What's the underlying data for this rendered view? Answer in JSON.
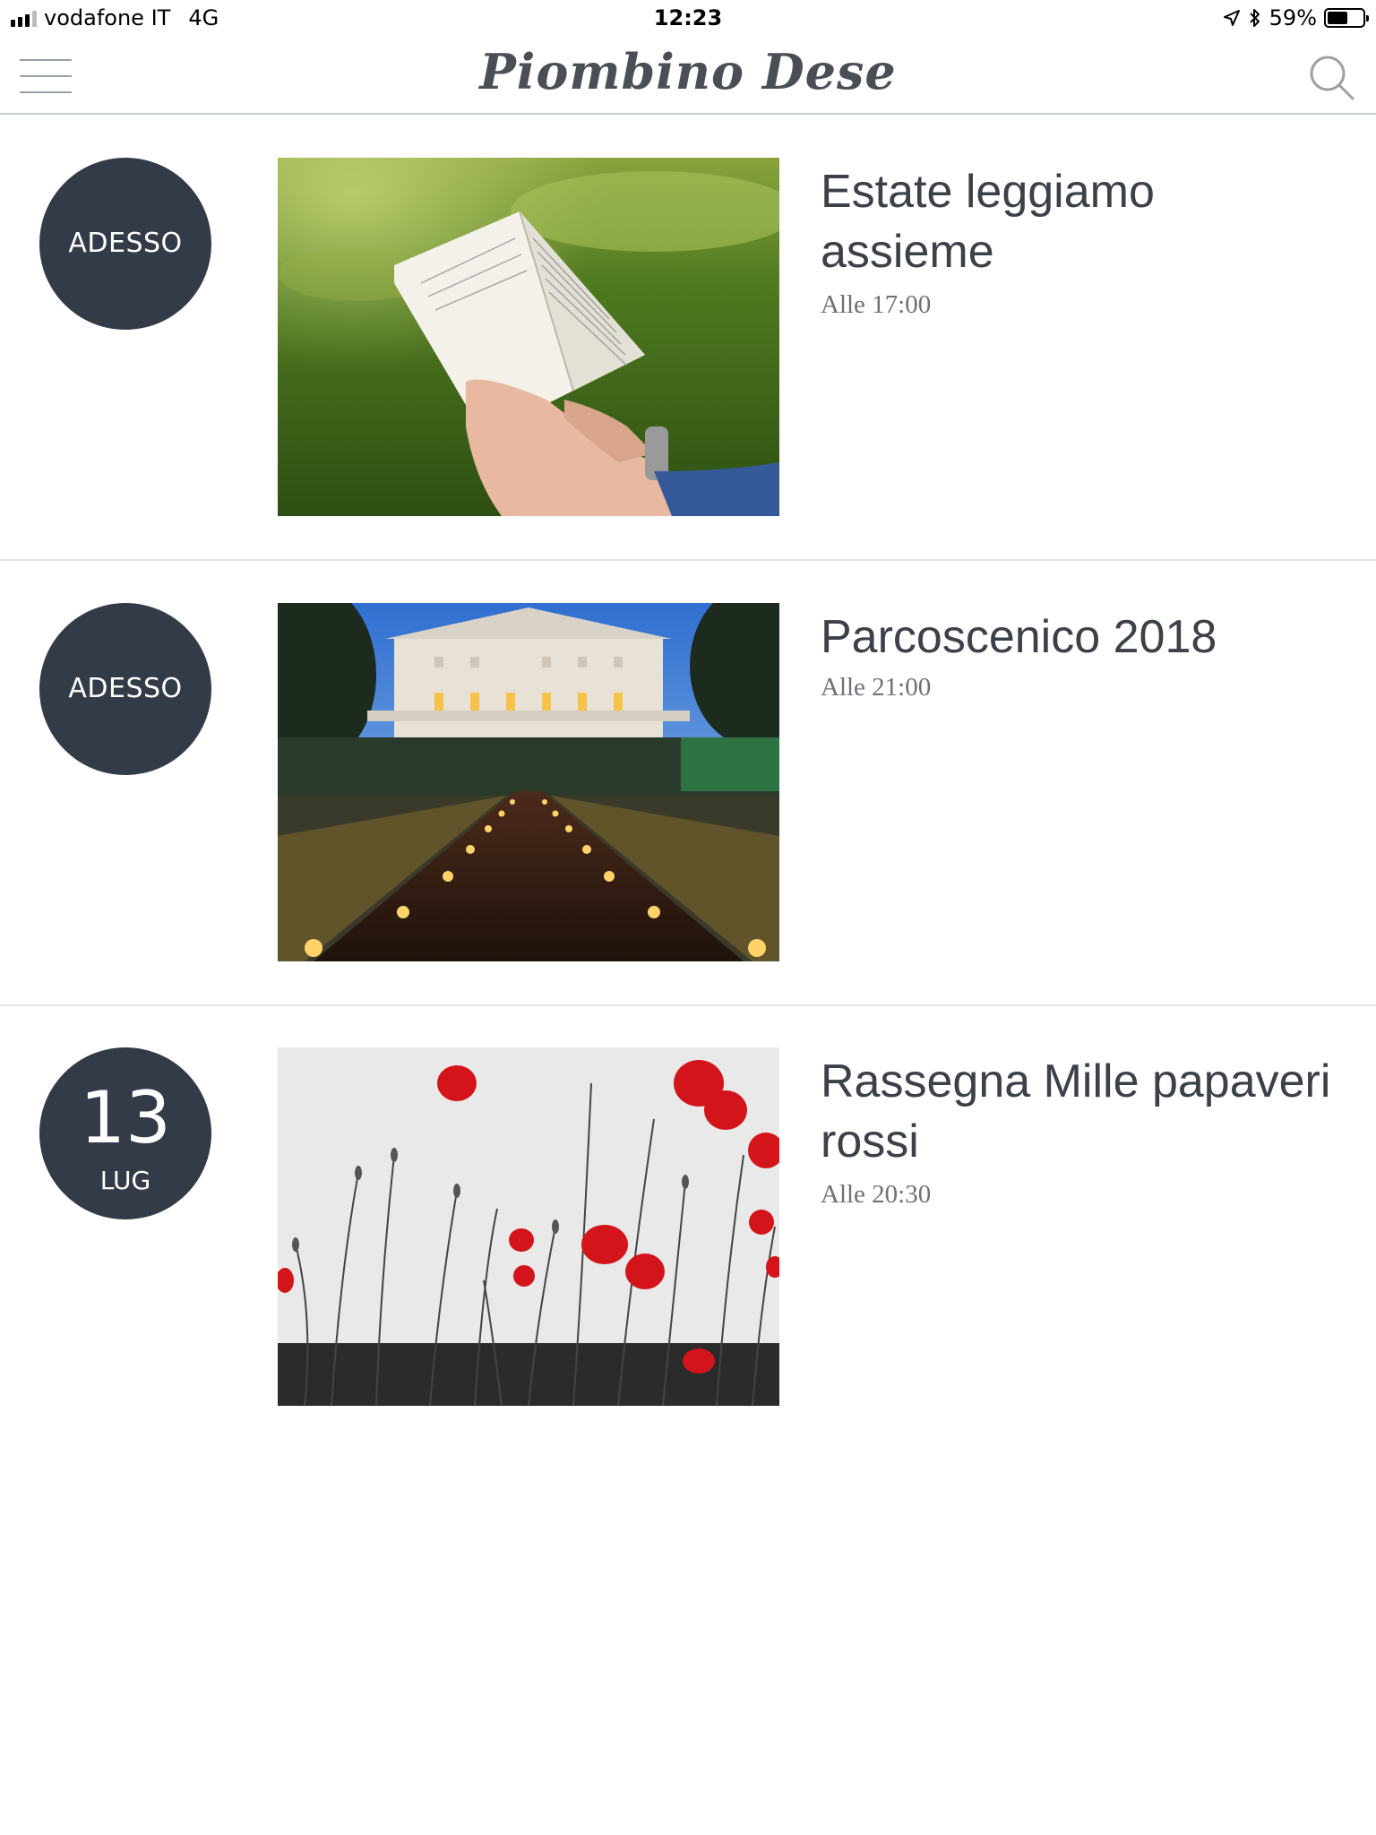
{
  "status_bar": {
    "carrier": "vodafone IT",
    "network": "4G",
    "time": "12:23",
    "battery_percent": "59%",
    "battery_level": 0.59,
    "icons": [
      "signal-icon",
      "location-arrow-icon",
      "bluetooth-icon",
      "battery-icon"
    ]
  },
  "navbar": {
    "brand": "Piombino Dese",
    "menu_icon": "hamburger-menu-icon",
    "search_icon": "search-icon"
  },
  "events": [
    {
      "badge_text": "ADESSO",
      "title": "Estate leggiamo assieme",
      "time": "Alle 17:00",
      "image": "book-reading-photo"
    },
    {
      "badge_text": "ADESSO",
      "title": "Parcoscenico 2018",
      "time": "Alle 21:00",
      "image": "villa-night-candles-photo"
    },
    {
      "badge_day": "13",
      "badge_month": "LUG",
      "title": "Rassegna Mille papaveri rossi",
      "time": "Alle 20:30",
      "image": "red-poppies-photo"
    }
  ],
  "colors": {
    "badge_bg": "#333a48",
    "text": "#3b4049",
    "divider": "#e3e6e8",
    "poppy_red": "#d4141b"
  }
}
